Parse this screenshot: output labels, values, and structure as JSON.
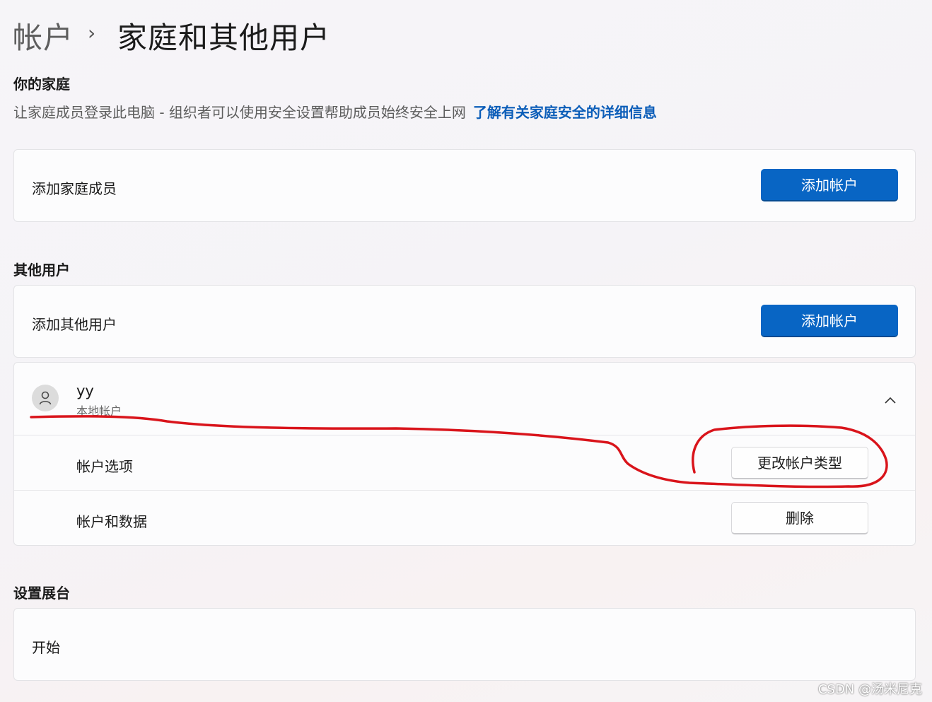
{
  "breadcrumb": {
    "parent": "帐户",
    "separator": "›",
    "current": "家庭和其他用户"
  },
  "family": {
    "heading": "你的家庭",
    "description": "让家庭成员登录此电脑 - 组织者可以使用安全设置帮助成员始终安全上网",
    "link": "了解有关家庭安全的详细信息",
    "add_member_label": "添加家庭成员",
    "add_account_button": "添加帐户"
  },
  "other_users": {
    "heading": "其他用户",
    "add_other_label": "添加其他用户",
    "add_account_button": "添加帐户",
    "user": {
      "name": "yy",
      "type": "本地帐户",
      "options_label": "帐户选项",
      "change_type_button": "更改帐户类型",
      "data_label": "帐户和数据",
      "delete_button": "删除"
    }
  },
  "kiosk": {
    "heading": "设置展台",
    "start_label": "开始"
  },
  "watermark": "CSDN @汤米尼克",
  "annotation_color": "#d9141b",
  "accent_color": "#0865c4"
}
